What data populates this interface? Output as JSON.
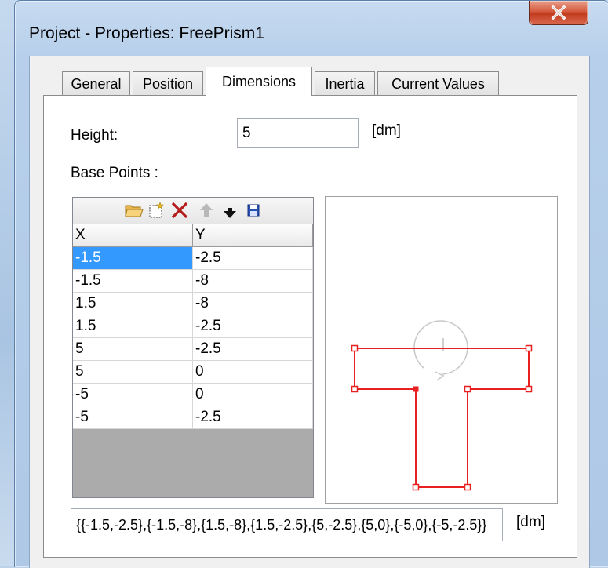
{
  "window": {
    "title": "Project - Properties: FreePrism1",
    "close_icon": "close-x-icon"
  },
  "tabs": [
    {
      "label": "General",
      "active": false
    },
    {
      "label": "Position",
      "active": false
    },
    {
      "label": "Dimensions",
      "active": true
    },
    {
      "label": "Inertia",
      "active": false
    },
    {
      "label": "Current Values",
      "active": false
    }
  ],
  "dimensions": {
    "height_label": "Height:",
    "height_value": "5",
    "height_unit": "[dm]",
    "base_points_label": "Base Points :",
    "toolbar_icons": [
      "open-folder-icon",
      "new-icon",
      "delete-icon",
      "move-up-icon",
      "move-down-icon",
      "save-icon"
    ],
    "columns": [
      "X",
      "Y"
    ],
    "rows": [
      [
        "-1.5",
        "-2.5"
      ],
      [
        "-1.5",
        "-8"
      ],
      [
        "1.5",
        "-8"
      ],
      [
        "1.5",
        "-2.5"
      ],
      [
        "5",
        "-2.5"
      ],
      [
        "5",
        "0"
      ],
      [
        "-5",
        "0"
      ],
      [
        "-5",
        "-2.5"
      ]
    ],
    "points_text": "{{-1.5,-2.5},{-1.5,-8},{1.5,-8},{1.5,-2.5},{5,-2.5},{5,0},{-5,0},{-5,-2.5}}",
    "points_unit": "[dm]"
  },
  "colors": {
    "selection": "#3399ff",
    "shape_outline": "#e82020",
    "close_button": "#c7432a"
  }
}
